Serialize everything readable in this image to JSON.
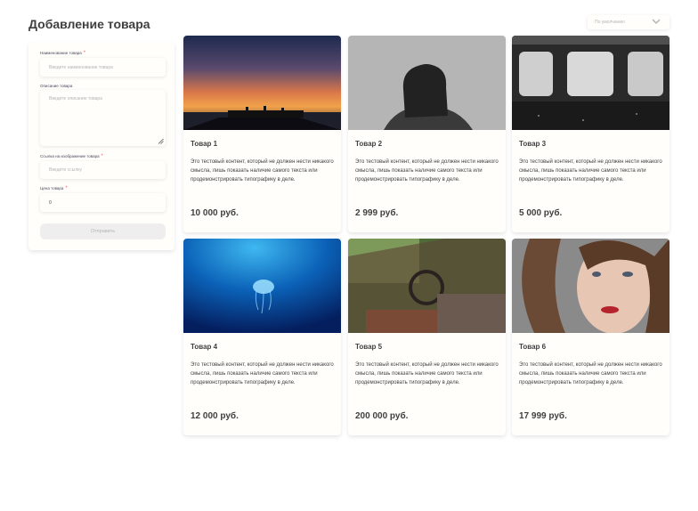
{
  "page": {
    "title": "Добавление товара"
  },
  "sort": {
    "value": "По умолчанию"
  },
  "form": {
    "name_label": "Наименование товара",
    "name_placeholder": "Введите наименование товара",
    "desc_label": "Описание товара",
    "desc_placeholder": "Введите описание товара",
    "image_label": "Ссылка на изображение товара",
    "image_placeholder": "Введите ссылку",
    "price_label": "Цена товара",
    "price_value": "0",
    "submit_label": "Отправить"
  },
  "products": [
    {
      "name": "Товар 1",
      "description": "Это тестовый контент, который не должен нести никакого смысла, лишь показать наличие самого текста или продемонстрировать типографику в деле.",
      "price": "10 000 руб.",
      "image": "sunset-pier"
    },
    {
      "name": "Товар 2",
      "description": "Это тестовый контент, который не должен нести никакого смысла, лишь показать наличие самого текста или продемонстрировать типографику в деле.",
      "price": "2 999 руб.",
      "image": "woman-silhouette"
    },
    {
      "name": "Товар 3",
      "description": "Это тестовый контент, который не должен нести никакого смысла, лишь показать наличие самого текста или продемонстрировать типографику в деле.",
      "price": "5 000 руб.",
      "image": "train-windows"
    },
    {
      "name": "Товар 4",
      "description": "Это тестовый контент, который не должен нести никакого смысла, лишь показать наличие самого текста или продемонстрировать типографику в деле.",
      "price": "12 000 руб.",
      "image": "jellyfish"
    },
    {
      "name": "Товар 5",
      "description": "Это тестовый контент, который не должен нести никакого смысла, лишь показать наличие самого текста или продемонстрировать типографику в деле.",
      "price": "200 000 руб.",
      "image": "abandoned-car"
    },
    {
      "name": "Товар 6",
      "description": "Это тестовый контент, который не должен нести никакого смысла, лишь показать наличие самого текста или продемонстрировать типографику в деле.",
      "price": "17 999 руб.",
      "image": "woman-portrait"
    }
  ],
  "colors": {
    "background": "#ffffff",
    "card": "#fffefb",
    "required": "#ff8484",
    "placeholder": "#b4b4b4",
    "text": "#3f3f3f",
    "button": "#eeeeee"
  }
}
